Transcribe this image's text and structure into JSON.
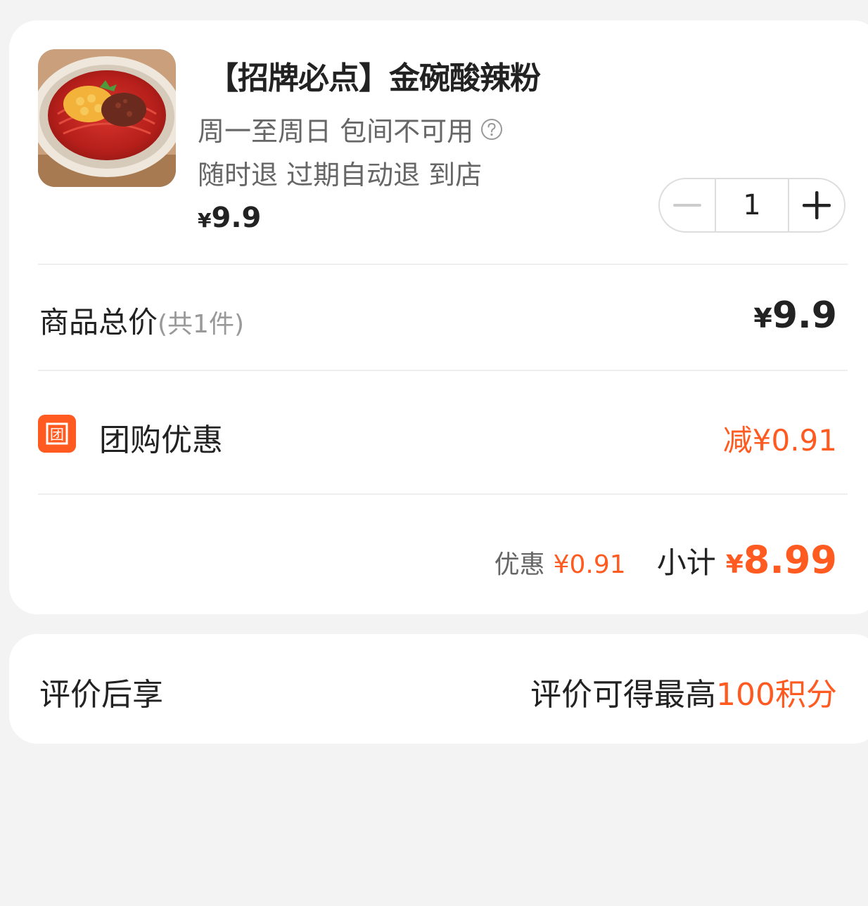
{
  "colors": {
    "accent": "#ff5a1f",
    "background": "#f3f3f3",
    "card": "#ffffff",
    "text_primary": "#222222",
    "text_secondary": "#666666",
    "text_muted": "#999999"
  },
  "product": {
    "image_icon": "food-image",
    "title": "【招牌必点】金碗酸辣粉",
    "usage_text": "周一至周日 包间不可用",
    "usage_help_icon": "help-circle-icon",
    "refund_text": "随时退 过期自动退 到店",
    "price_currency": "¥",
    "price_value": "9.9",
    "quantity": "1",
    "decrement_icon": "minus-icon",
    "increment_icon": "plus-icon"
  },
  "total": {
    "label": "商品总价",
    "count_text": "(共1件)",
    "currency": "¥",
    "value": "9.9"
  },
  "discount": {
    "badge_icon": "group-buy-badge-icon",
    "badge_text": "团",
    "label": "团购优惠",
    "value": "减¥0.91"
  },
  "summary": {
    "savings_label": "优惠",
    "savings_value": "¥0.91",
    "subtotal_label": "小计",
    "subtotal_currency": "¥",
    "subtotal_value": "8.99"
  },
  "review": {
    "label": "评价后享",
    "reward_prefix": "评价可得最高",
    "reward_amount": "100积分"
  }
}
